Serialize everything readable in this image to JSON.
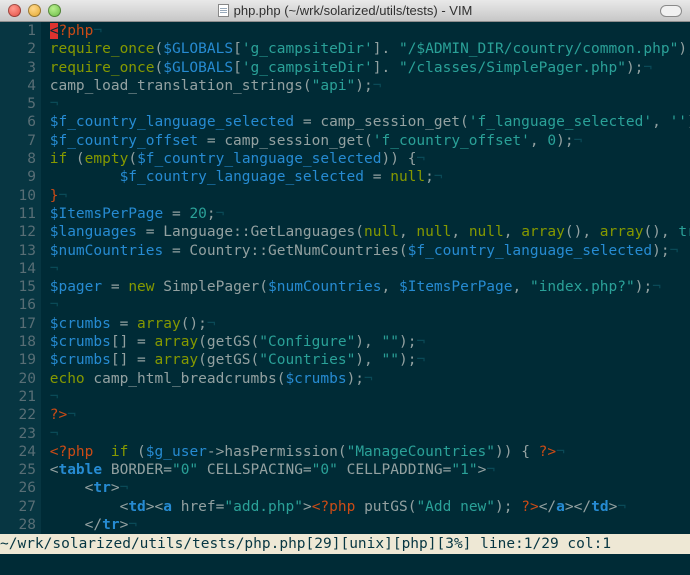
{
  "window": {
    "title": "php.php (~/wrk/solarized/utils/tests) - VIM"
  },
  "statusline": "~/wrk/solarized/utils/tests/php.php[29][unix][php][3%] line:1/29 col:1",
  "lines": [
    {
      "n": "1",
      "segs": [
        {
          "t": "<",
          "c": "cursor"
        },
        {
          "t": "?php",
          "c": "php"
        }
      ]
    },
    {
      "n": "2",
      "segs": [
        {
          "t": "require_once",
          "c": "kw"
        },
        {
          "t": "(",
          "c": "plain"
        },
        {
          "t": "$GLOBALS",
          "c": "var"
        },
        {
          "t": "[",
          "c": "plain"
        },
        {
          "t": "'g_campsiteDir'",
          "c": "str"
        },
        {
          "t": "]. ",
          "c": "plain"
        },
        {
          "t": "\"/$ADMIN_DIR/country/common.php\"",
          "c": "str"
        },
        {
          "t": ");",
          "c": "plain"
        }
      ]
    },
    {
      "n": "3",
      "segs": [
        {
          "t": "require_once",
          "c": "kw"
        },
        {
          "t": "(",
          "c": "plain"
        },
        {
          "t": "$GLOBALS",
          "c": "var"
        },
        {
          "t": "[",
          "c": "plain"
        },
        {
          "t": "'g_campsiteDir'",
          "c": "str"
        },
        {
          "t": "]. ",
          "c": "plain"
        },
        {
          "t": "\"/classes/SimplePager.php\"",
          "c": "str"
        },
        {
          "t": ");",
          "c": "plain"
        }
      ]
    },
    {
      "n": "4",
      "segs": [
        {
          "t": "camp_load_translation_strings(",
          "c": "plain"
        },
        {
          "t": "\"api\"",
          "c": "str"
        },
        {
          "t": ");",
          "c": "plain"
        }
      ]
    },
    {
      "n": "5",
      "segs": []
    },
    {
      "n": "6",
      "segs": [
        {
          "t": "$f_country_language_selected",
          "c": "var"
        },
        {
          "t": " = camp_session_get(",
          "c": "plain"
        },
        {
          "t": "'f_language_selected'",
          "c": "str"
        },
        {
          "t": ", ",
          "c": "plain"
        },
        {
          "t": "''",
          "c": "str"
        },
        {
          "t": ");",
          "c": "plain"
        }
      ]
    },
    {
      "n": "7",
      "segs": [
        {
          "t": "$f_country_offset",
          "c": "var"
        },
        {
          "t": " = camp_session_get(",
          "c": "plain"
        },
        {
          "t": "'f_country_offset'",
          "c": "str"
        },
        {
          "t": ", ",
          "c": "plain"
        },
        {
          "t": "0",
          "c": "str"
        },
        {
          "t": ");",
          "c": "plain"
        }
      ]
    },
    {
      "n": "8",
      "segs": [
        {
          "t": "if",
          "c": "kw"
        },
        {
          "t": " (",
          "c": "plain"
        },
        {
          "t": "empty",
          "c": "kw"
        },
        {
          "t": "(",
          "c": "plain"
        },
        {
          "t": "$f_country_language_selected",
          "c": "var"
        },
        {
          "t": ")) {",
          "c": "plain"
        }
      ]
    },
    {
      "n": "9",
      "segs": [
        {
          "t": "        ",
          "c": "plain"
        },
        {
          "t": "$f_country_language_selected",
          "c": "var"
        },
        {
          "t": " = ",
          "c": "plain"
        },
        {
          "t": "null",
          "c": "kw"
        },
        {
          "t": ";",
          "c": "plain"
        }
      ]
    },
    {
      "n": "10",
      "segs": [
        {
          "t": "}",
          "c": "php"
        }
      ]
    },
    {
      "n": "11",
      "segs": [
        {
          "t": "$ItemsPerPage",
          "c": "var"
        },
        {
          "t": " = ",
          "c": "plain"
        },
        {
          "t": "20",
          "c": "str"
        },
        {
          "t": ";",
          "c": "plain"
        }
      ]
    },
    {
      "n": "12",
      "segs": [
        {
          "t": "$languages",
          "c": "var"
        },
        {
          "t": " = Language::GetLanguages(",
          "c": "plain"
        },
        {
          "t": "null",
          "c": "kw"
        },
        {
          "t": ", ",
          "c": "plain"
        },
        {
          "t": "null",
          "c": "kw"
        },
        {
          "t": ", ",
          "c": "plain"
        },
        {
          "t": "null",
          "c": "kw"
        },
        {
          "t": ", ",
          "c": "plain"
        },
        {
          "t": "array",
          "c": "kw"
        },
        {
          "t": "(), ",
          "c": "plain"
        },
        {
          "t": "array",
          "c": "kw"
        },
        {
          "t": "(), ",
          "c": "plain"
        },
        {
          "t": "true",
          "c": "str"
        },
        {
          "t": ");",
          "c": "plain"
        }
      ]
    },
    {
      "n": "13",
      "segs": [
        {
          "t": "$numCountries",
          "c": "var"
        },
        {
          "t": " = Country::GetNumCountries(",
          "c": "plain"
        },
        {
          "t": "$f_country_language_selected",
          "c": "var"
        },
        {
          "t": ");",
          "c": "plain"
        }
      ]
    },
    {
      "n": "14",
      "segs": []
    },
    {
      "n": "15",
      "segs": [
        {
          "t": "$pager",
          "c": "var"
        },
        {
          "t": " = ",
          "c": "plain"
        },
        {
          "t": "new",
          "c": "kw"
        },
        {
          "t": " SimplePager(",
          "c": "plain"
        },
        {
          "t": "$numCountries",
          "c": "var"
        },
        {
          "t": ", ",
          "c": "plain"
        },
        {
          "t": "$ItemsPerPage",
          "c": "var"
        },
        {
          "t": ", ",
          "c": "plain"
        },
        {
          "t": "\"index.php?\"",
          "c": "str"
        },
        {
          "t": ");",
          "c": "plain"
        }
      ]
    },
    {
      "n": "16",
      "segs": []
    },
    {
      "n": "17",
      "segs": [
        {
          "t": "$crumbs",
          "c": "var"
        },
        {
          "t": " = ",
          "c": "plain"
        },
        {
          "t": "array",
          "c": "kw"
        },
        {
          "t": "();",
          "c": "plain"
        }
      ]
    },
    {
      "n": "18",
      "segs": [
        {
          "t": "$crumbs",
          "c": "var"
        },
        {
          "t": "[] = ",
          "c": "plain"
        },
        {
          "t": "array",
          "c": "kw"
        },
        {
          "t": "(getGS(",
          "c": "plain"
        },
        {
          "t": "\"Configure\"",
          "c": "str"
        },
        {
          "t": "), ",
          "c": "plain"
        },
        {
          "t": "\"\"",
          "c": "str"
        },
        {
          "t": ");",
          "c": "plain"
        }
      ]
    },
    {
      "n": "19",
      "segs": [
        {
          "t": "$crumbs",
          "c": "var"
        },
        {
          "t": "[] = ",
          "c": "plain"
        },
        {
          "t": "array",
          "c": "kw"
        },
        {
          "t": "(getGS(",
          "c": "plain"
        },
        {
          "t": "\"Countries\"",
          "c": "str"
        },
        {
          "t": "), ",
          "c": "plain"
        },
        {
          "t": "\"\"",
          "c": "str"
        },
        {
          "t": ");",
          "c": "plain"
        }
      ]
    },
    {
      "n": "20",
      "segs": [
        {
          "t": "echo",
          "c": "kw"
        },
        {
          "t": " camp_html_breadcrumbs(",
          "c": "plain"
        },
        {
          "t": "$crumbs",
          "c": "var"
        },
        {
          "t": ");",
          "c": "plain"
        }
      ]
    },
    {
      "n": "21",
      "segs": []
    },
    {
      "n": "22",
      "segs": [
        {
          "t": "?>",
          "c": "php"
        }
      ]
    },
    {
      "n": "23",
      "segs": []
    },
    {
      "n": "24",
      "segs": [
        {
          "t": "<?php",
          "c": "php"
        },
        {
          "t": "  ",
          "c": "plain"
        },
        {
          "t": "if",
          "c": "kw"
        },
        {
          "t": " (",
          "c": "plain"
        },
        {
          "t": "$g_user",
          "c": "var"
        },
        {
          "t": "->hasPermission(",
          "c": "plain"
        },
        {
          "t": "\"ManageCountries\"",
          "c": "str"
        },
        {
          "t": ")) { ",
          "c": "plain"
        },
        {
          "t": "?>",
          "c": "php"
        }
      ]
    },
    {
      "n": "25",
      "segs": [
        {
          "t": "<",
          "c": "plain"
        },
        {
          "t": "table",
          "c": "tag"
        },
        {
          "t": " BORDER=",
          "c": "plain"
        },
        {
          "t": "\"0\"",
          "c": "str"
        },
        {
          "t": " CELLSPACING=",
          "c": "plain"
        },
        {
          "t": "\"0\"",
          "c": "str"
        },
        {
          "t": " CELLPADDING=",
          "c": "plain"
        },
        {
          "t": "\"1\"",
          "c": "str"
        },
        {
          "t": ">",
          "c": "plain"
        }
      ]
    },
    {
      "n": "26",
      "segs": [
        {
          "t": "    <",
          "c": "plain"
        },
        {
          "t": "tr",
          "c": "tag"
        },
        {
          "t": ">",
          "c": "plain"
        }
      ]
    },
    {
      "n": "27",
      "segs": [
        {
          "t": "        <",
          "c": "plain"
        },
        {
          "t": "td",
          "c": "tag"
        },
        {
          "t": "><",
          "c": "plain"
        },
        {
          "t": "a",
          "c": "tag"
        },
        {
          "t": " href=",
          "c": "plain"
        },
        {
          "t": "\"add.php\"",
          "c": "str"
        },
        {
          "t": ">",
          "c": "plain"
        },
        {
          "t": "<?php",
          "c": "php"
        },
        {
          "t": " putGS(",
          "c": "plain"
        },
        {
          "t": "\"Add new\"",
          "c": "str"
        },
        {
          "t": "); ",
          "c": "plain"
        },
        {
          "t": "?>",
          "c": "php"
        },
        {
          "t": "</",
          "c": "plain"
        },
        {
          "t": "a",
          "c": "tag"
        },
        {
          "t": "></",
          "c": "plain"
        },
        {
          "t": "td",
          "c": "tag"
        },
        {
          "t": ">",
          "c": "plain"
        }
      ]
    },
    {
      "n": "28",
      "segs": [
        {
          "t": "    </",
          "c": "plain"
        },
        {
          "t": "tr",
          "c": "tag"
        },
        {
          "t": ">",
          "c": "plain"
        }
      ]
    }
  ]
}
